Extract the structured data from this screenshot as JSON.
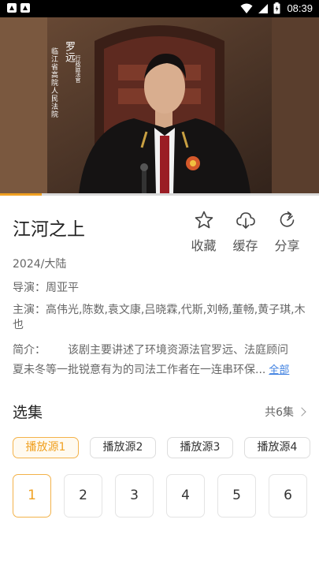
{
  "status_bar": {
    "time": "08:39",
    "icons": [
      "gallery-icon",
      "gallery-icon",
      "wifi-icon",
      "signal-icon",
      "battery-icon"
    ]
  },
  "player": {
    "caption": {
      "name": "罗远",
      "org": "临江省高院人民法院",
      "role": "行政庭法官"
    },
    "progress": 0.13,
    "accent": "#f0a020"
  },
  "show": {
    "title": "江河之上",
    "year_region": "2024/大陆",
    "director": "导演：周亚平",
    "cast": "主演：高伟光,陈数,袁文康,吕晓霖,代斯,刘畅,董畅,黄子琪,木也",
    "intro_label": "简介：",
    "intro_line1": "该剧主要讲述了环境资源法官罗远、法庭顾问",
    "intro_line2": "夏未冬等一批锐意有为的司法工作者在一连串环保...",
    "intro_more": "全部"
  },
  "actions": [
    {
      "label": "收藏",
      "icon": "star-icon"
    },
    {
      "label": "缓存",
      "icon": "cloud-download-icon"
    },
    {
      "label": "分享",
      "icon": "share-icon"
    }
  ],
  "episodes_section": {
    "title": "选集",
    "count": "共6集",
    "sources": [
      "播放源1",
      "播放源2",
      "播放源3",
      "播放源4"
    ],
    "active_source": 0,
    "episodes": [
      "1",
      "2",
      "3",
      "4",
      "5",
      "6"
    ],
    "active_episode": 0
  }
}
